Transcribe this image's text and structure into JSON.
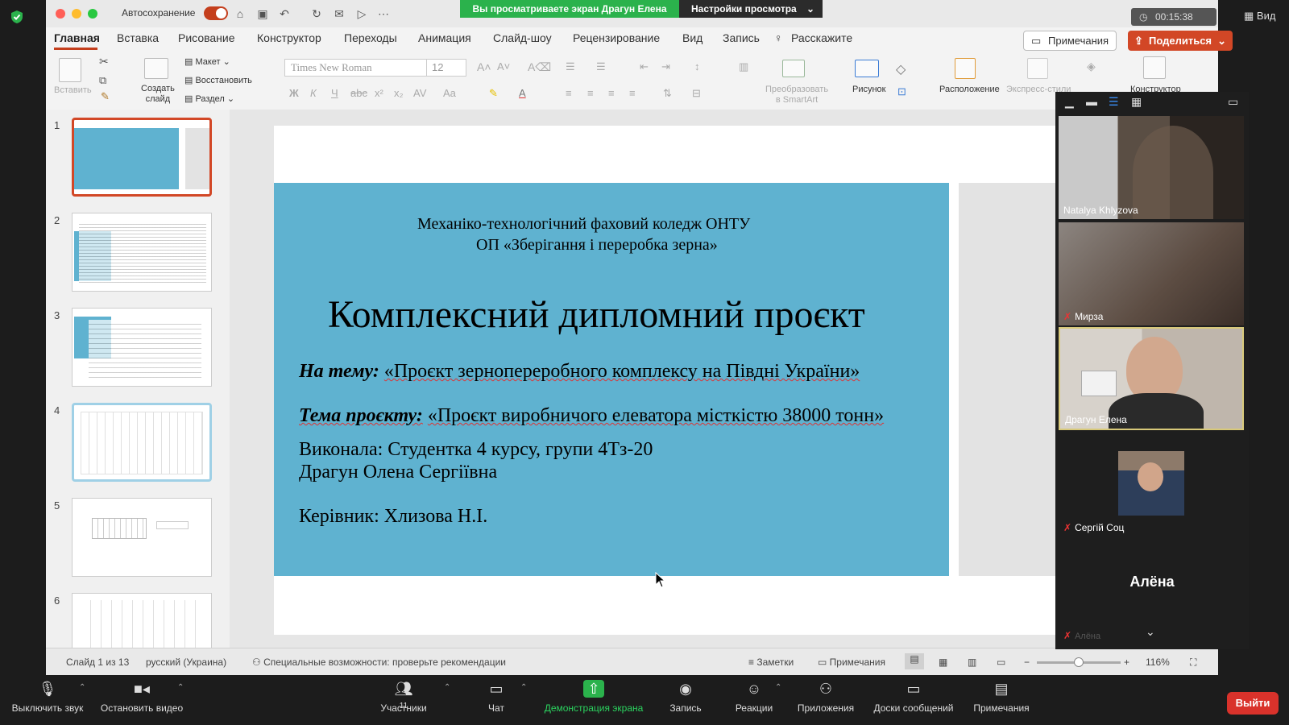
{
  "zoom": {
    "share_banner": "Вы просматриваете экран Драгун Елена",
    "view_settings": "Настройки просмотра",
    "timer": "00:15:38",
    "view_button": "Вид",
    "participants_count": "11",
    "bottom_bar": {
      "mute": "Выключить звук",
      "stop_video": "Остановить видео",
      "participants": "Участники",
      "chat": "Чат",
      "share_screen": "Демонстрация экрана",
      "record": "Запись",
      "reactions": "Реакции",
      "apps": "Приложения",
      "whiteboards": "Доски сообщений",
      "notes": "Примечания",
      "exit": "Выйти"
    },
    "participants": [
      {
        "name": "Natalya Khlyzova",
        "muted": false
      },
      {
        "name": "Мирза",
        "muted": true
      },
      {
        "name": "Драгун Елена",
        "muted": false
      },
      {
        "name": "Сергій Соц",
        "muted": true
      }
    ],
    "audio_only_name": "Алёна",
    "audio_only_sub": "Алёна"
  },
  "ppt": {
    "autosave_label": "Автосохранение",
    "tabs": [
      "Главная",
      "Вставка",
      "Рисование",
      "Конструктор",
      "Переходы",
      "Анимация",
      "Слайд-шоу",
      "Рецензирование",
      "Вид",
      "Запись"
    ],
    "tell_me": "Расскажите",
    "notes_button": "Примечания",
    "share_button": "Поделиться",
    "ribbon": {
      "paste": "Вставить",
      "new_slide_1": "Создать",
      "new_slide_2": "слайд",
      "layout": "Макет",
      "reset": "Восстановить",
      "section": "Раздел",
      "font": "Times New Roman",
      "size": "12",
      "smartart_1": "Преобразовать",
      "smartart_2": "в SmartArt",
      "picture": "Рисунок",
      "arrange": "Расположение",
      "quick_styles": "Экспресс-стили",
      "designer": "Конструктор"
    },
    "slide_numbers": [
      "1",
      "2",
      "3",
      "4",
      "5",
      "6"
    ],
    "slide": {
      "line1": "Механіко-технологічний фаховий коледж ОНТУ",
      "line2": "ОП «Зберігання і переробка зерна»",
      "title": "Комплексний дипломний проєкт",
      "topic_label": "На тему:",
      "topic_text": "«Проєкт зернопереробного комплексу на Півдні України»",
      "project_label": "Тема проєкту:",
      "project_text": "«Проєкт виробничого елеватора місткістю 38000 тонн»",
      "author_1": "Виконала: Студентка 4 курсу, групи 4Тз-20",
      "author_2": "Драгун Олена Сергіївна",
      "supervisor": "Керівник: Хлизова Н.І."
    },
    "status": {
      "slide_info": "Слайд 1 из 13",
      "language": "русский (Украина)",
      "accessibility": "Специальные возможности: проверьте рекомендации",
      "notes": "Заметки",
      "comments": "Примечания",
      "zoom": "116%"
    }
  },
  "colors": {
    "accent": "#c43e1c",
    "slide_blue": "#5fb2d0",
    "zoom_green": "#2bb24c",
    "exit_red": "#d9322b"
  }
}
